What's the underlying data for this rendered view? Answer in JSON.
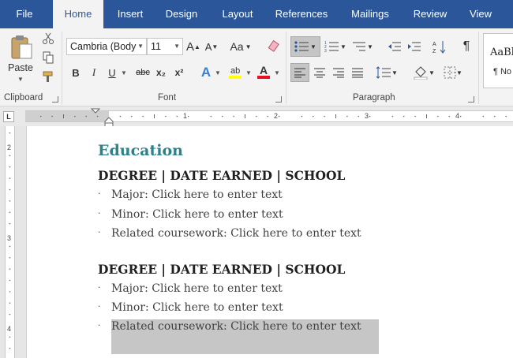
{
  "tabs": [
    "File",
    "Home",
    "Insert",
    "Design",
    "Layout",
    "References",
    "Mailings",
    "Review",
    "View"
  ],
  "active_tab": "Home",
  "clipboard": {
    "paste_label": "Paste",
    "group_label": "Clipboard"
  },
  "font": {
    "name": "Cambria (Body)",
    "name_display": "Cambria (Body",
    "size": "11",
    "grow": "A",
    "shrink": "A",
    "change_case": "Aa",
    "bold": "B",
    "italic": "I",
    "underline": "U",
    "strike": "abc",
    "subscript": "x₂",
    "superscript": "x²",
    "effects": "A",
    "font_color": "A",
    "group_label": "Font",
    "highlight_color": "#ffff00",
    "font_color_value": "#e81123"
  },
  "paragraph": {
    "group_label": "Paragraph",
    "pilcrow": "¶"
  },
  "styles": {
    "preview": "AaBl",
    "normal": "¶ No"
  },
  "ruler": {
    "h_numbers": [
      "1",
      "2",
      "3",
      "4"
    ],
    "v_numbers": [
      "2",
      "3",
      "4"
    ],
    "tab_selector": "L"
  },
  "document": {
    "heading": "Education",
    "entries": [
      {
        "title": "DEGREE | DATE EARNED | SCHOOL",
        "bullets": [
          "Major: Click here to enter text",
          "Minor: Click here to enter text",
          "Related coursework: Click here to enter text"
        ]
      },
      {
        "title": "DEGREE | DATE EARNED | SCHOOL",
        "bullets": [
          "Major: Click here to enter text",
          "Minor: Click here to enter text",
          "Related coursework: Click here to enter text"
        ]
      }
    ],
    "bullet_char": "·"
  },
  "colors": {
    "ribbon_blue": "#2b579a",
    "heading_teal": "#2e8189"
  }
}
